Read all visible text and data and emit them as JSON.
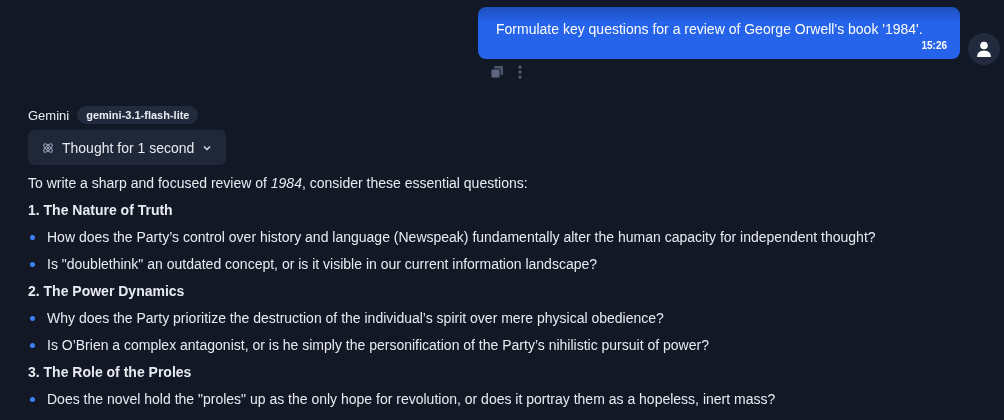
{
  "user_message": {
    "text": "Formulate key questions for a review of George Orwell's book '1984'.",
    "time": "15:26"
  },
  "reply": {
    "author": "Gemini",
    "model": "gemini-3.1-flash-lite",
    "thought": {
      "label": "Thought for 1 second",
      "expanded": false
    },
    "intro": "To write a sharp and focused review of *1984*, consider these essential questions:",
    "sections": [
      {
        "heading": "1. The Nature of Truth",
        "bullets": [
          "How does the Party’s control over history and language (Newspeak) fundamentally alter the human capacity for independent thought?",
          "Is \"doublethink\" an outdated concept, or is it visible in our current information landscape?"
        ]
      },
      {
        "heading": "2. The Power Dynamics",
        "bullets": [
          "Why does the Party prioritize the destruction of the individual’s spirit over mere physical obedience?",
          "Is O’Brien a complex antagonist, or is he simply the personification of the Party’s nihilistic pursuit of power?"
        ]
      },
      {
        "heading": "3. The Role of the Proles",
        "bullets": [
          "Does the novel hold the \"proles\" up as the only hope for revolution, or does it portray them as a hopeless, inert mass?"
        ]
      }
    ]
  }
}
